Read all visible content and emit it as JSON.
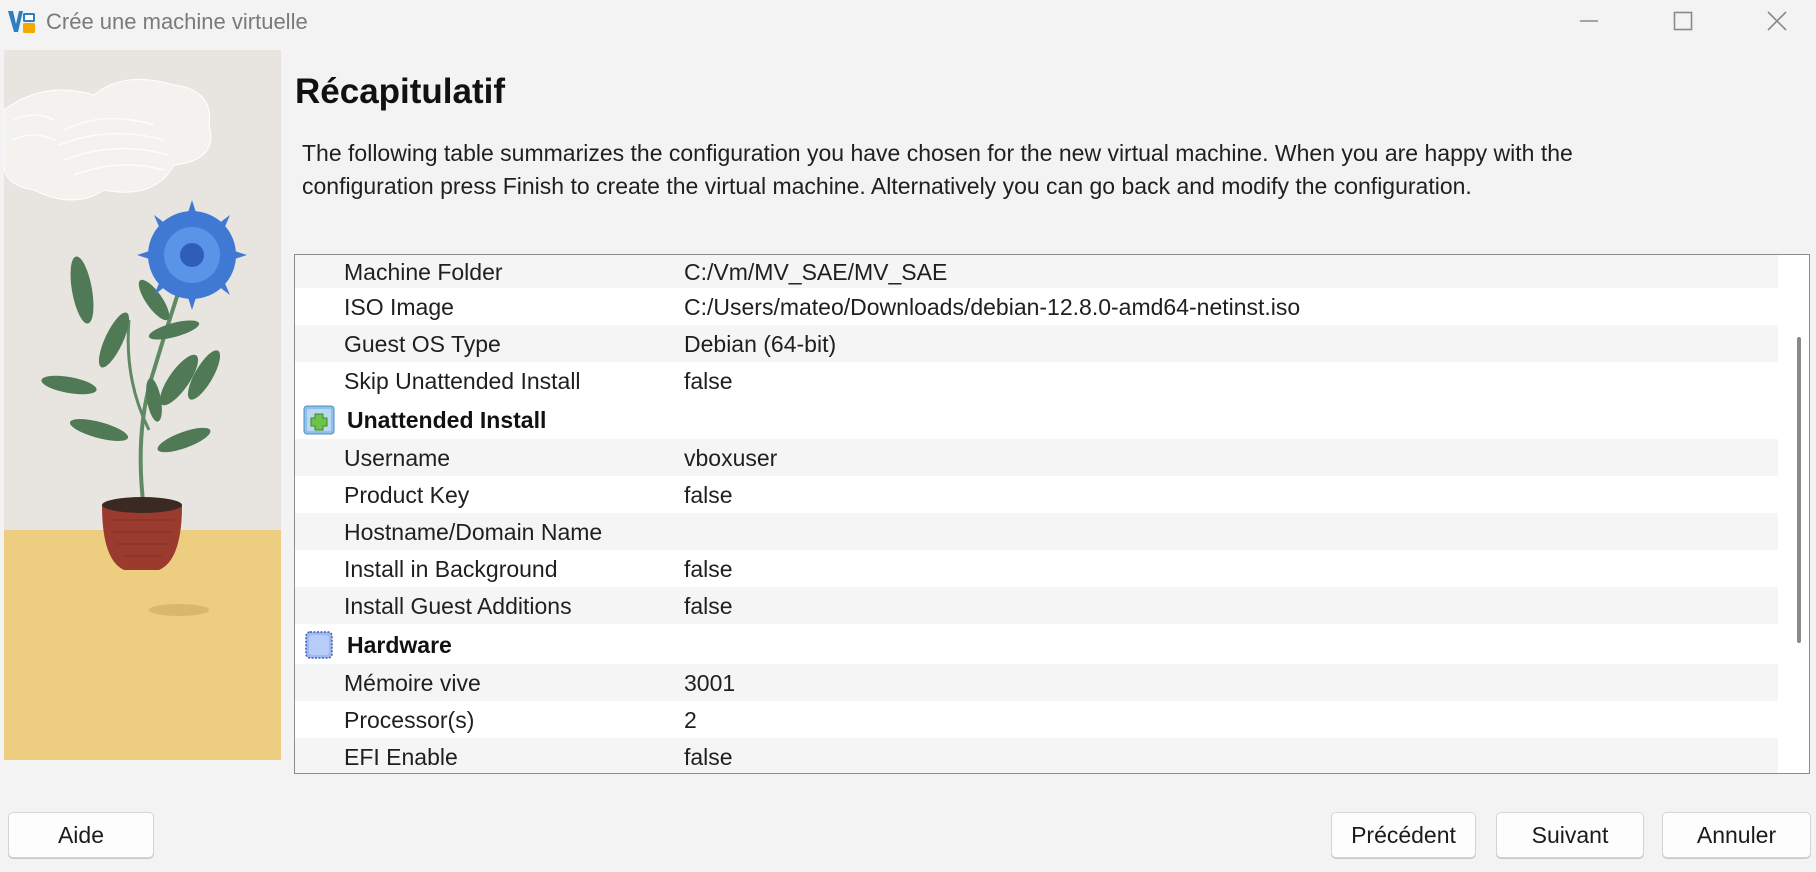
{
  "window": {
    "title": "Crée une machine virtuelle",
    "accent": "#2f7fc0"
  },
  "page": {
    "title": "Récapitulatif",
    "description": "The following table summarizes the configuration you have chosen for the new virtual machine. When you are happy with the configuration press Finish to create the virtual machine. Alternatively you can go back and modify the configuration."
  },
  "summary": {
    "general": [
      {
        "key": "Machine Folder",
        "value": "C:/Vm/MV_SAE/MV_SAE"
      },
      {
        "key": "ISO Image",
        "value": "C:/Users/mateo/Downloads/debian-12.8.0-amd64-netinst.iso"
      },
      {
        "key": "Guest OS Type",
        "value": "Debian (64-bit)"
      },
      {
        "key": "Skip Unattended Install",
        "value": "false"
      }
    ],
    "unattended": {
      "title": "Unattended Install",
      "icon": "unattended-install-icon",
      "rows": [
        {
          "key": "Username",
          "value": "vboxuser"
        },
        {
          "key": "Product Key",
          "value": "false"
        },
        {
          "key": "Hostname/Domain Name",
          "value": ""
        },
        {
          "key": "Install in Background",
          "value": "false"
        },
        {
          "key": "Install Guest Additions",
          "value": "false"
        }
      ]
    },
    "hardware": {
      "title": "Hardware",
      "icon": "hardware-chip-icon",
      "rows": [
        {
          "key": "Mémoire vive",
          "value": "3001"
        },
        {
          "key": "Processor(s)",
          "value": "2"
        },
        {
          "key": "EFI Enable",
          "value": "false"
        }
      ]
    }
  },
  "buttons": {
    "help": "Aide",
    "previous": "Précédent",
    "next": "Suivant",
    "cancel": "Annuler"
  }
}
